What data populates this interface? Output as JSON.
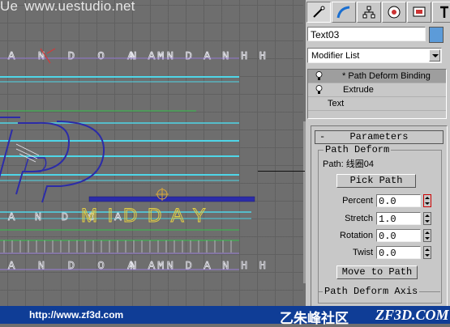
{
  "watermark": {
    "logo": "Ue",
    "text": "www.uestudio.net"
  },
  "viewport": {
    "text_rows": [
      "A N D O A M     N A N D A N H H",
      "A N D O A M  N A N D A N H H"
    ],
    "path_text": "M I D D A Y",
    "line_colors": {
      "cyan": "#4fd6e8",
      "green": "#33c24a",
      "blue": "#2c2ca8",
      "violet": "#9a7fd8",
      "yellow": "#e3cf44"
    }
  },
  "panel": {
    "tabs": [
      {
        "icon": "create-icon",
        "active": true
      },
      {
        "icon": "modify-icon",
        "active": false
      },
      {
        "icon": "hierarchy-icon",
        "active": false
      },
      {
        "icon": "motion-icon",
        "active": false
      },
      {
        "icon": "display-icon",
        "active": false
      },
      {
        "icon": "utilities-icon",
        "active": false
      }
    ],
    "object_name": "Text03",
    "object_color": "#5c9bd9",
    "modifier_list": "Modifier List",
    "stack": [
      {
        "label": "* Path Deform Binding",
        "selected": true
      },
      {
        "label": "Extrude",
        "selected": false
      },
      {
        "label": "Text",
        "selected": false
      }
    ],
    "rollout": {
      "minus": "-",
      "title": "Parameters",
      "group_title": "Path Deform",
      "path_label": "Path: 线圈04",
      "pick_path": "Pick Path",
      "fields": [
        {
          "label": "Percent",
          "value": "0.0"
        },
        {
          "label": "Stretch",
          "value": "1.0"
        },
        {
          "label": "Rotation",
          "value": "0.0"
        },
        {
          "label": "Twist",
          "value": "0.0"
        }
      ],
      "move_to_path": "Move to Path",
      "axis_group_title": "Path Deform Axis"
    }
  },
  "footer": {
    "url": "http://www.zf3d.com",
    "brand": "乙朱峰社区",
    "site": "ZF3D.COM"
  }
}
